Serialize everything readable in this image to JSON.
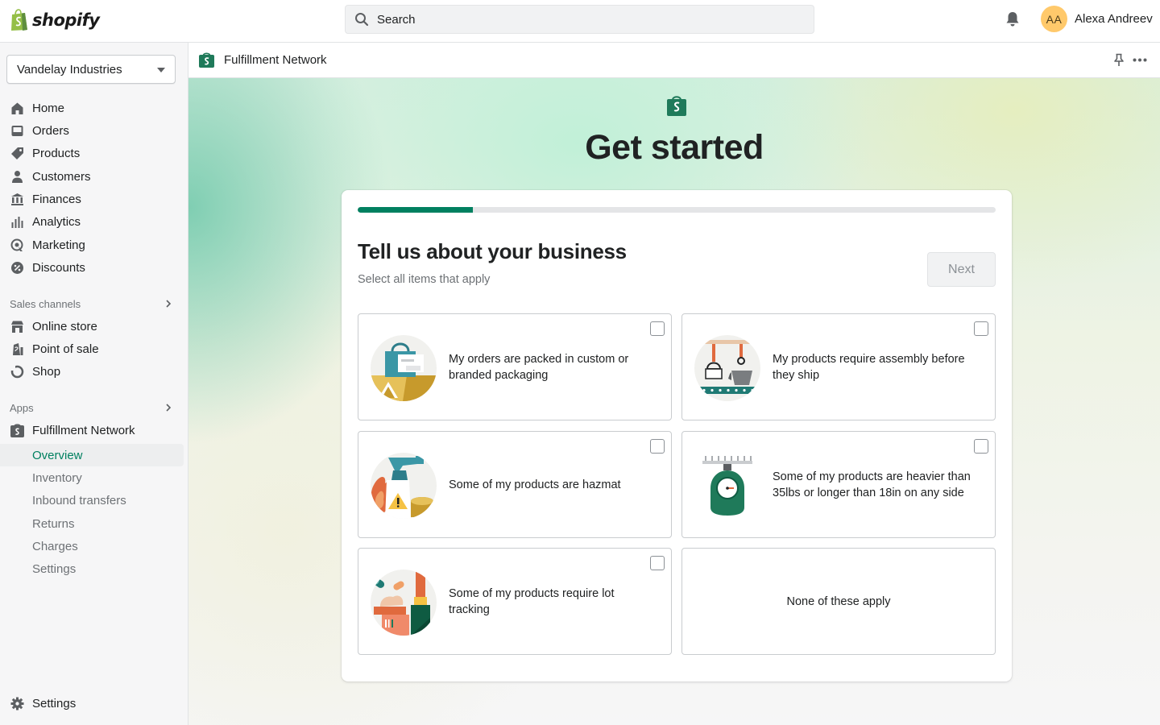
{
  "topbar": {
    "brand": "shopify",
    "search_placeholder": "Search",
    "avatar_initials": "AA",
    "user_name": "Alexa Andreev"
  },
  "sidebar": {
    "store": "Vandelay Industries",
    "nav": [
      {
        "label": "Home",
        "icon": "home-icon"
      },
      {
        "label": "Orders",
        "icon": "orders-icon"
      },
      {
        "label": "Products",
        "icon": "tag-icon"
      },
      {
        "label": "Customers",
        "icon": "person-icon"
      },
      {
        "label": "Finances",
        "icon": "bank-icon"
      },
      {
        "label": "Analytics",
        "icon": "bar-chart-icon"
      },
      {
        "label": "Marketing",
        "icon": "target-icon"
      },
      {
        "label": "Discounts",
        "icon": "discount-icon"
      }
    ],
    "sales_channels_title": "Sales channels",
    "sales_channels": [
      {
        "label": "Online store",
        "icon": "store-icon"
      },
      {
        "label": "Point of sale",
        "icon": "pos-icon"
      },
      {
        "label": "Shop",
        "icon": "shop-icon"
      }
    ],
    "apps_title": "Apps",
    "app": {
      "label": "Fulfillment Network",
      "icon": "shopify-bag-icon"
    },
    "app_subnav": [
      {
        "label": "Overview",
        "active": true
      },
      {
        "label": "Inventory"
      },
      {
        "label": "Inbound transfers"
      },
      {
        "label": "Returns"
      },
      {
        "label": "Charges"
      },
      {
        "label": "Settings"
      }
    ],
    "settings_label": "Settings"
  },
  "appbar": {
    "title": "Fulfillment Network"
  },
  "main": {
    "hero_title": "Get started",
    "progress_percent": 18,
    "card_title": "Tell us about your business",
    "card_subtitle": "Select all items that apply",
    "next_label": "Next",
    "options": [
      {
        "text": "My orders are packed in custom or branded packaging",
        "illustration": "packaging-illustration"
      },
      {
        "text": "My products require assembly before they ship",
        "illustration": "assembly-illustration"
      },
      {
        "text": "Some of my products are hazmat",
        "illustration": "hazmat-illustration"
      },
      {
        "text": "Some of my products are heavier than 35lbs or longer than 18in on any side",
        "illustration": "scale-illustration"
      },
      {
        "text": "Some of my products require lot tracking",
        "illustration": "lot-tracking-illustration"
      },
      {
        "text": "None of these apply"
      }
    ]
  },
  "colors": {
    "accent": "#008060",
    "avatar": "#ffc96b",
    "brand_green": "#95bf47"
  }
}
